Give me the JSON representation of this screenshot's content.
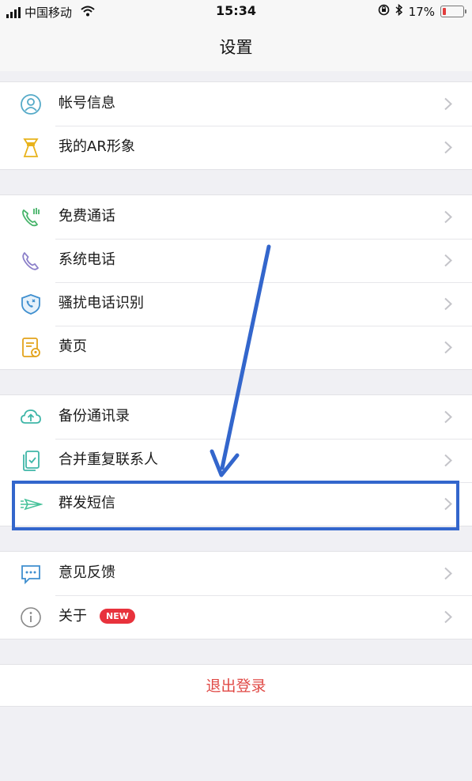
{
  "status_bar": {
    "carrier": "中国移动",
    "time": "15:34",
    "battery": "17%",
    "battery_level": 0.17,
    "icons": [
      "signal-icon",
      "wifi-icon",
      "orientation-lock-icon",
      "bluetooth-icon",
      "battery-icon"
    ]
  },
  "nav": {
    "title": "设置"
  },
  "groups": [
    {
      "items": [
        {
          "label": "帐号信息",
          "icon": "account-icon"
        },
        {
          "label": "我的AR形象",
          "icon": "ar-avatar-icon"
        }
      ]
    },
    {
      "items": [
        {
          "label": "免费通话",
          "icon": "free-call-icon"
        },
        {
          "label": "系统电话",
          "icon": "phone-icon"
        },
        {
          "label": "骚扰电话识别",
          "icon": "shield-call-icon"
        },
        {
          "label": "黄页",
          "icon": "yellow-pages-icon"
        }
      ]
    },
    {
      "items": [
        {
          "label": "备份通讯录",
          "icon": "cloud-upload-icon"
        },
        {
          "label": "合并重复联系人",
          "icon": "merge-contacts-icon"
        },
        {
          "label": "群发短信",
          "icon": "send-message-icon"
        }
      ]
    },
    {
      "items": [
        {
          "label": "意见反馈",
          "icon": "feedback-icon"
        },
        {
          "label": "关于",
          "icon": "info-icon",
          "badge": "NEW"
        }
      ]
    }
  ],
  "logout": {
    "label": "退出登录"
  },
  "colors": {
    "accent_red": "#e04a46",
    "badge_red": "#e8323c",
    "annotation_blue": "#3366cc"
  }
}
